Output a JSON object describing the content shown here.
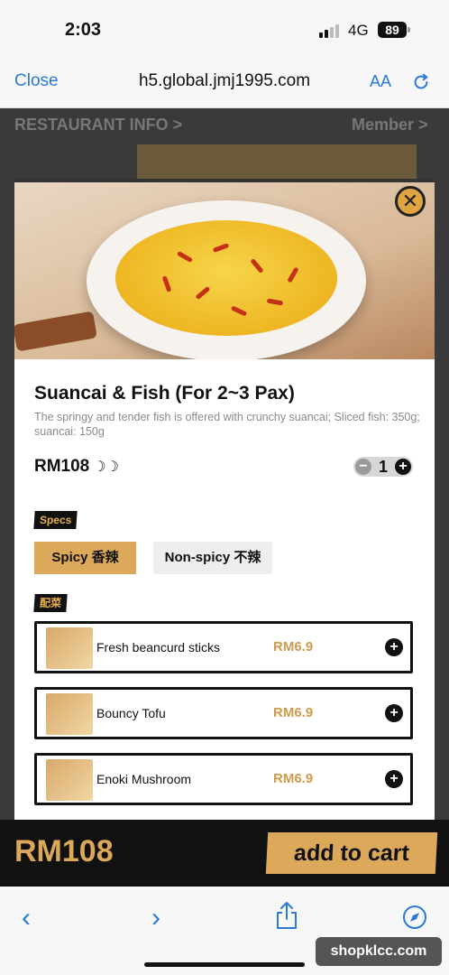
{
  "status_bar": {
    "time": "2:03",
    "network": "4G",
    "battery": "89"
  },
  "browser": {
    "close_label": "Close",
    "url": "h5.global.jmj1995.com",
    "text_size_label": "AA"
  },
  "background_page": {
    "header": "RESTAURANT INFO >",
    "member": "Member >"
  },
  "dish": {
    "name": "Suancai & Fish (For 2~3 Pax)",
    "description": "The springy and tender fish is offered with crunchy suancai; Sliced fish: 350g; suancai: 150g",
    "price": "RM108",
    "spice_marks": "☽☽",
    "quantity": "1"
  },
  "specs": {
    "label": "Specs",
    "options": [
      {
        "label": "Spicy 香辣",
        "selected": true
      },
      {
        "label": "Non-spicy 不辣",
        "selected": false
      }
    ]
  },
  "sides": {
    "label": "配菜",
    "items": [
      {
        "name": "Fresh beancurd sticks",
        "price": "RM6.9"
      },
      {
        "name": "Bouncy Tofu",
        "price": "RM6.9"
      },
      {
        "name": "Enoki Mushroom",
        "price": "RM6.9"
      }
    ]
  },
  "cart": {
    "total": "RM108",
    "add_label": "add to cart"
  },
  "watermark": "shopklcc.com",
  "colors": {
    "accent": "#dca859",
    "link": "#2a7ad9"
  }
}
